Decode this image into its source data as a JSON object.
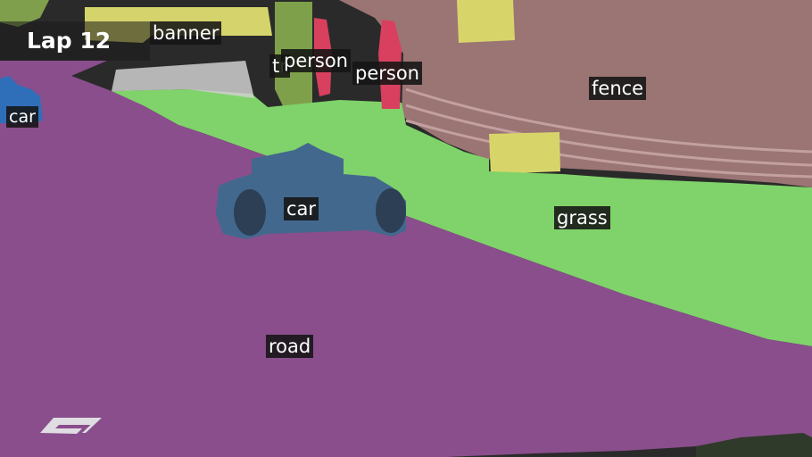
{
  "overlay": {
    "lap_text": "Lap 12",
    "logo": "F1"
  },
  "labels": {
    "banner": "banner",
    "truck_partial": "tr",
    "person_1": "person",
    "person_2": "person",
    "fence": "fence",
    "car_left": "car",
    "car_main": "car",
    "grass": "grass",
    "road": "road"
  },
  "colors": {
    "road": "#8a4f8c",
    "grass": "#7fd36a",
    "fence": "#9a7272",
    "banner": "#d7d56a",
    "person": "#d8405e",
    "car": "#3f6a8f",
    "tree": "#7ea04a"
  }
}
